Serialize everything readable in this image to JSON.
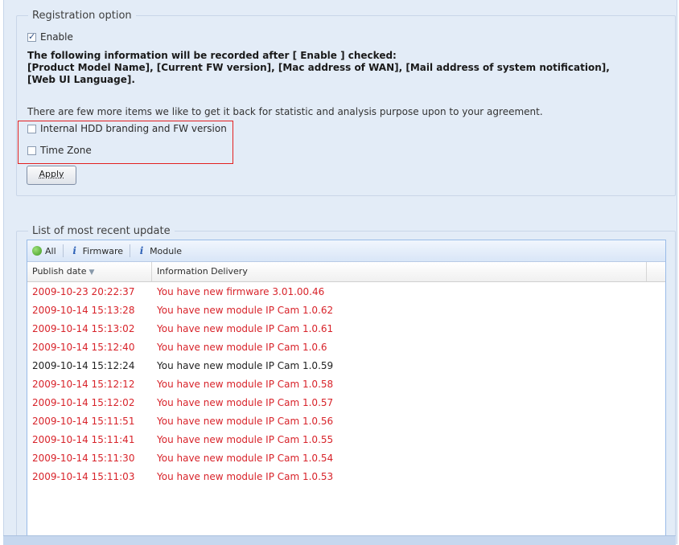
{
  "registration": {
    "legend": "Registration option",
    "enable_label": "Enable",
    "enable_checked": true,
    "info_line1": "The following information will be recorded after [ Enable ] checked:",
    "info_line2": "[Product Model Name], [Current FW version], [Mac address of WAN], [Mail address of system notification],",
    "info_line3": "[Web UI Language].",
    "extra_text": "There are few more items we like to get it back for statistic and analysis purpose upon to your agreement.",
    "option1_label": "Internal HDD branding and FW version",
    "option1_checked": false,
    "option2_label": "Time Zone",
    "option2_checked": false,
    "apply_label": "Apply"
  },
  "updates": {
    "legend": "List of most recent update",
    "toolbar": {
      "all_label": "All",
      "firmware_label": "Firmware",
      "module_label": "Module"
    },
    "columns": [
      "Publish date",
      "Information Delivery"
    ],
    "rows": [
      {
        "date": "2009-10-23 20:22:37",
        "info": "You have new firmware 3.01.00.46",
        "color": "#d8232a"
      },
      {
        "date": "2009-10-14 15:13:28",
        "info": "You have new module IP Cam 1.0.62",
        "color": "#d8232a"
      },
      {
        "date": "2009-10-14 15:13:02",
        "info": "You have new module IP Cam 1.0.61",
        "color": "#d8232a"
      },
      {
        "date": "2009-10-14 15:12:40",
        "info": "You have new module IP Cam 1.0.6",
        "color": "#d8232a"
      },
      {
        "date": "2009-10-14 15:12:24",
        "info": "You have new module IP Cam 1.0.59",
        "color": "#222222"
      },
      {
        "date": "2009-10-14 15:12:12",
        "info": "You have new module IP Cam 1.0.58",
        "color": "#d8232a"
      },
      {
        "date": "2009-10-14 15:12:02",
        "info": "You have new module IP Cam 1.0.57",
        "color": "#d8232a"
      },
      {
        "date": "2009-10-14 15:11:51",
        "info": "You have new module IP Cam 1.0.56",
        "color": "#d8232a"
      },
      {
        "date": "2009-10-14 15:11:41",
        "info": "You have new module IP Cam 1.0.55",
        "color": "#d8232a"
      },
      {
        "date": "2009-10-14 15:11:30",
        "info": "You have new module IP Cam 1.0.54",
        "color": "#d8232a"
      },
      {
        "date": "2009-10-14 15:11:03",
        "info": "You have new module IP Cam 1.0.53",
        "color": "#d8232a"
      }
    ]
  },
  "colors": {
    "panel_bg": "#e3ecf7",
    "highlight_red": "#e32020",
    "unread_red": "#d8232a"
  }
}
